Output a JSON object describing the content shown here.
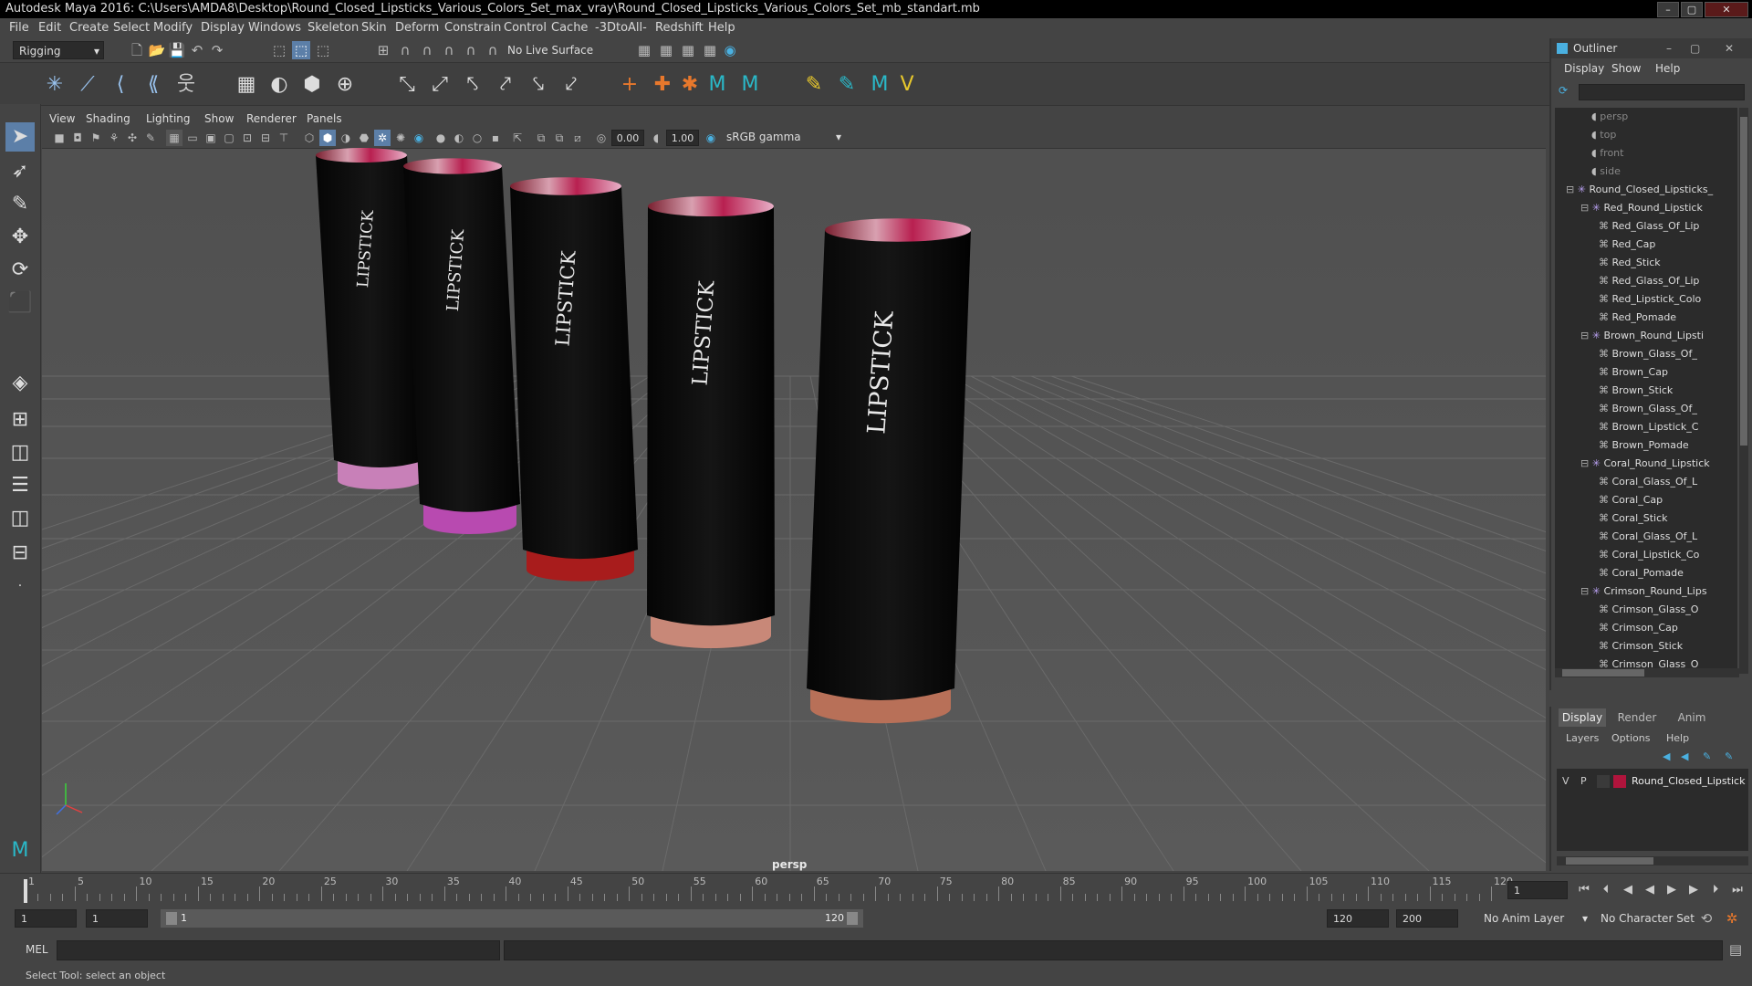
{
  "window": {
    "title": "Autodesk Maya 2016: C:\\Users\\AMDA8\\Desktop\\Round_Closed_Lipsticks_Various_Colors_Set_max_vray\\Round_Closed_Lipsticks_Various_Colors_Set_mb_standart.mb",
    "minimize": "–",
    "maximize": "▢",
    "close": "✕"
  },
  "menubar": [
    "File",
    "Edit",
    "Create",
    "Select",
    "Modify",
    "Display",
    "Windows",
    "Skeleton",
    "Skin",
    "Deform",
    "Constrain",
    "Control",
    "Cache",
    "-3DtoAll-",
    "Redshift",
    "Help"
  ],
  "toolbar": {
    "menuset": "Rigging",
    "live_surface": "No Live Surface"
  },
  "viewport": {
    "menu": [
      "View",
      "Shading",
      "Lighting",
      "Show",
      "Renderer",
      "Panels"
    ],
    "exposure": "0.00",
    "gamma": "1.00",
    "colorspace": "sRGB gamma",
    "camera": "persp",
    "lipstick_label": "LIPSTICK"
  },
  "lipsticks": [
    {
      "band_color": "#c880b8"
    },
    {
      "band_color": "#b84ab0"
    },
    {
      "band_color": "#a81c1c"
    },
    {
      "band_color": "#c88878"
    },
    {
      "band_color": "#b87058"
    }
  ],
  "outliner": {
    "title": "Outliner",
    "menu": [
      "Display",
      "Show",
      "Help"
    ],
    "items": [
      {
        "label": "persp",
        "type": "camera"
      },
      {
        "label": "top",
        "type": "camera"
      },
      {
        "label": "front",
        "type": "camera"
      },
      {
        "label": "side",
        "type": "camera"
      },
      {
        "label": "Round_Closed_Lipsticks_",
        "type": "group"
      },
      {
        "label": "Red_Round_Lipstick",
        "type": "group"
      },
      {
        "label": "Red_Glass_Of_Lip",
        "type": "mesh"
      },
      {
        "label": "Red_Cap",
        "type": "mesh"
      },
      {
        "label": "Red_Stick",
        "type": "mesh"
      },
      {
        "label": "Red_Glass_Of_Lip",
        "type": "mesh"
      },
      {
        "label": "Red_Lipstick_Colo",
        "type": "mesh"
      },
      {
        "label": "Red_Pomade",
        "type": "mesh"
      },
      {
        "label": "Brown_Round_Lipsti",
        "type": "group"
      },
      {
        "label": "Brown_Glass_Of_",
        "type": "mesh"
      },
      {
        "label": "Brown_Cap",
        "type": "mesh"
      },
      {
        "label": "Brown_Stick",
        "type": "mesh"
      },
      {
        "label": "Brown_Glass_Of_",
        "type": "mesh"
      },
      {
        "label": "Brown_Lipstick_C",
        "type": "mesh"
      },
      {
        "label": "Brown_Pomade",
        "type": "mesh"
      },
      {
        "label": "Coral_Round_Lipstick",
        "type": "group"
      },
      {
        "label": "Coral_Glass_Of_L",
        "type": "mesh"
      },
      {
        "label": "Coral_Cap",
        "type": "mesh"
      },
      {
        "label": "Coral_Stick",
        "type": "mesh"
      },
      {
        "label": "Coral_Glass_Of_L",
        "type": "mesh"
      },
      {
        "label": "Coral_Lipstick_Co",
        "type": "mesh"
      },
      {
        "label": "Coral_Pomade",
        "type": "mesh"
      },
      {
        "label": "Crimson_Round_Lips",
        "type": "group"
      },
      {
        "label": "Crimson_Glass_O",
        "type": "mesh"
      },
      {
        "label": "Crimson_Cap",
        "type": "mesh"
      },
      {
        "label": "Crimson_Stick",
        "type": "mesh"
      },
      {
        "label": "Crimson_Glass_O",
        "type": "mesh"
      }
    ]
  },
  "layers": {
    "tabs": [
      "Display",
      "Render",
      "Anim"
    ],
    "menu": [
      "Layers",
      "Options",
      "Help"
    ],
    "layer": {
      "v": "V",
      "p": "P",
      "name": "Round_Closed_Lipstick",
      "color": "#b0143c"
    }
  },
  "timeline": {
    "ticks": [
      "1",
      "5",
      "10",
      "15",
      "20",
      "25",
      "30",
      "35",
      "40",
      "45",
      "50",
      "55",
      "60",
      "65",
      "70",
      "75",
      "80",
      "85",
      "90",
      "95",
      "100",
      "105",
      "110",
      "115",
      "120"
    ],
    "current_frame": "1"
  },
  "range": {
    "start": "1",
    "playback_start": "1",
    "slider_start": "1",
    "slider_end": "120",
    "playback_end": "120",
    "end": "200",
    "anim_layer": "No Anim Layer",
    "character_set": "No Character Set"
  },
  "command": {
    "lang": "MEL"
  },
  "help": {
    "text": "Select Tool: select an object"
  }
}
